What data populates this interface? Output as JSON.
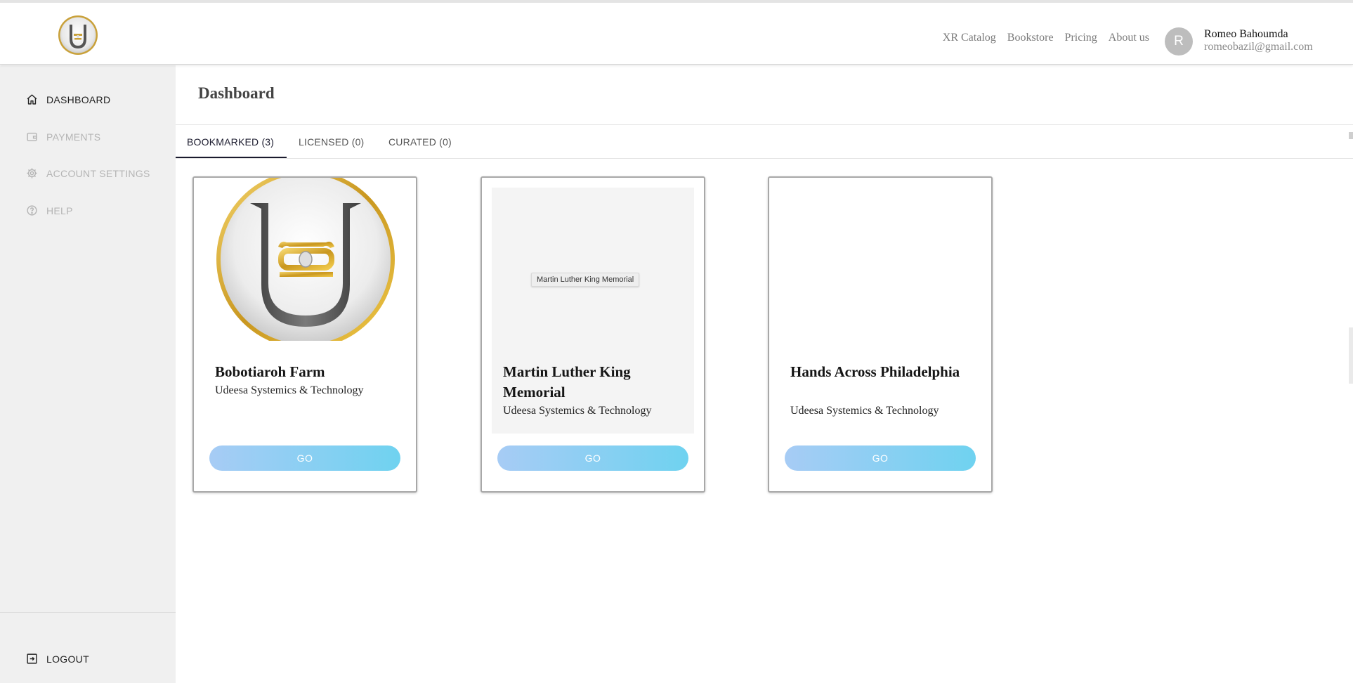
{
  "header": {
    "nav": [
      "XR Catalog",
      "Bookstore",
      "Pricing",
      "About us"
    ],
    "user": {
      "initial": "R",
      "name": "Romeo Bahoumda",
      "email": "romeobazil@gmail.com"
    }
  },
  "sidebar": {
    "items": [
      {
        "label": "DASHBOARD",
        "icon": "home-icon",
        "active": true
      },
      {
        "label": "PAYMENTS",
        "icon": "wallet-icon",
        "active": false
      },
      {
        "label": "ACCOUNT SETTINGS",
        "icon": "gear-icon",
        "active": false
      },
      {
        "label": "HELP",
        "icon": "help-icon",
        "active": false
      }
    ],
    "logout": {
      "label": "LOGOUT",
      "icon": "logout-icon"
    }
  },
  "main": {
    "title": "Dashboard",
    "tabs": [
      {
        "label": "BOOKMARKED (3)",
        "active": true
      },
      {
        "label": "LICENSED (0)",
        "active": false
      },
      {
        "label": "CURATED (0)",
        "active": false
      }
    ],
    "cards": [
      {
        "title": "Bobotiaroh Farm",
        "subtitle": "Udeesa Systemics & Technology",
        "button": "GO",
        "image": "udeesa-logo"
      },
      {
        "title": "Martin Luther King Memorial",
        "subtitle": "Udeesa Systemics & Technology",
        "button": "GO",
        "image_alt": "Martin Luther King Memorial"
      },
      {
        "title": "Hands Across Philadelphia",
        "subtitle": "Udeesa Systemics & Technology",
        "button": "GO"
      }
    ]
  },
  "colors": {
    "button_gradient_start": "#a7ccf5",
    "button_gradient_end": "#6fd2f0",
    "sidebar_bg": "#f0f0f0",
    "logo_gold": "#d4a92a"
  }
}
